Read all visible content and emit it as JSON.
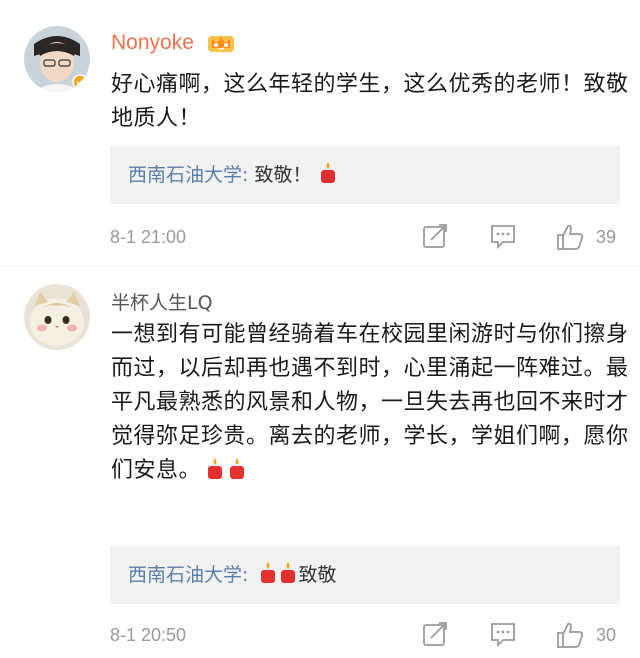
{
  "comments": [
    {
      "username": "Nonyoke",
      "text": "好心痛啊，这么年轻的学生，这么优秀的老师！致敬地质人！",
      "reply": {
        "author": "西南石油大学:",
        "text": " 致敬！"
      },
      "timestamp": "8-1 21:00",
      "likes": "39"
    },
    {
      "username": "半杯人生LQ",
      "text": "一想到有可能曾经骑着车在校园里闲游时与你们擦身而过，以后却再也遇不到时，心里涌起一阵难过。最平凡最熟悉的风景和人物，一旦失去再也回不来时才觉得弥足珍贵。离去的老师，学长，学姐们啊，愿你们安息。",
      "reply": {
        "author": "西南石油大学:",
        "text": "致敬"
      },
      "timestamp": "8-1 20:50",
      "likes": "30"
    }
  ],
  "colors": {
    "vip_username": "#eb7350",
    "reply_author": "#5b7ea8",
    "meta_text": "#999999",
    "reply_bg": "#f2f2f2",
    "candle": "#e5312f"
  },
  "icons": [
    "crown-vip-icon",
    "verified-badge-icon",
    "candle-icon",
    "share-icon",
    "comment-icon",
    "like-icon"
  ]
}
